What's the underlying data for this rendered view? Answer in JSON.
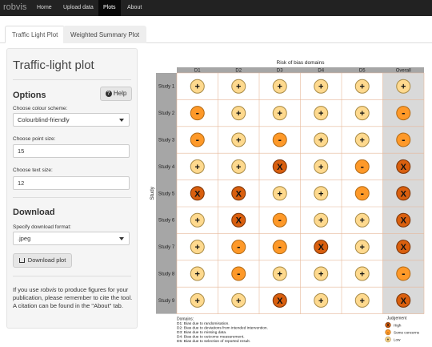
{
  "navbar": {
    "brand": "robvis",
    "items": [
      "Home",
      "Upload data",
      "Plots",
      "About"
    ],
    "active": "Plots"
  },
  "tabs": [
    "Traffic Light Plot",
    "Weighted Summary Plot"
  ],
  "sidebar": {
    "title": "Traffic-light plot",
    "options_heading": "Options",
    "help_label": "Help",
    "colour_label": "Choose colour scheme:",
    "colour_value": "Colourblind-friendly",
    "point_label": "Choose point size:",
    "point_value": "15",
    "text_label": "Choose text size:",
    "text_value": "12",
    "download_heading": "Download",
    "format_label": "Specify download format:",
    "format_value": ".jpeg",
    "download_button": "Download plot",
    "note_pre": "If you use ",
    "note_app": "robvis",
    "note_post": " to produce figures for your publication, please remember to cite the tool. A citation can be found in the \"About\" tab."
  },
  "plot": {
    "title": "Risk of bias domains",
    "y_axis_label": "Study",
    "domains": [
      "D1",
      "D2",
      "D3",
      "D4",
      "D5",
      "Overall"
    ],
    "studies": [
      "Study 1",
      "Study 2",
      "Study 3",
      "Study 4",
      "Study 5",
      "Study 6",
      "Study 7",
      "Study 8",
      "Study 9"
    ],
    "judgements": [
      [
        "+",
        "+",
        "+",
        "+",
        "+",
        "+"
      ],
      [
        "-",
        "+",
        "+",
        "+",
        "+",
        "-"
      ],
      [
        "-",
        "+",
        "-",
        "+",
        "+",
        "-"
      ],
      [
        "+",
        "+",
        "X",
        "+",
        "-",
        "X"
      ],
      [
        "X",
        "X",
        "+",
        "+",
        "-",
        "X"
      ],
      [
        "+",
        "X",
        "-",
        "+",
        "+",
        "X"
      ],
      [
        "+",
        "-",
        "-",
        "X",
        "+",
        "X"
      ],
      [
        "+",
        "-",
        "+",
        "+",
        "+",
        "-"
      ],
      [
        "+",
        "+",
        "X",
        "+",
        "+",
        "X"
      ]
    ],
    "domains_heading": "Domains:",
    "domain_notes": [
      "D1: Bias due to randomisation.",
      "D2: Bias due to deviations from intended intervention.",
      "D3: Bias due to missing data.",
      "D4: Bias due to outcome measurement.",
      "D5: Bias due to selection of reported result."
    ],
    "legend_title": "Judgement",
    "legend": [
      {
        "symbol": "X",
        "label": "High"
      },
      {
        "symbol": "-",
        "label": "Some concerns"
      },
      {
        "symbol": "+",
        "label": "Low"
      }
    ],
    "colors": {
      "high": "#d95f0e",
      "some": "#fe9929",
      "low": "#fed98e",
      "high_stroke": "#7a3305",
      "some_stroke": "#b36a14",
      "low_stroke": "#a88a45"
    }
  }
}
